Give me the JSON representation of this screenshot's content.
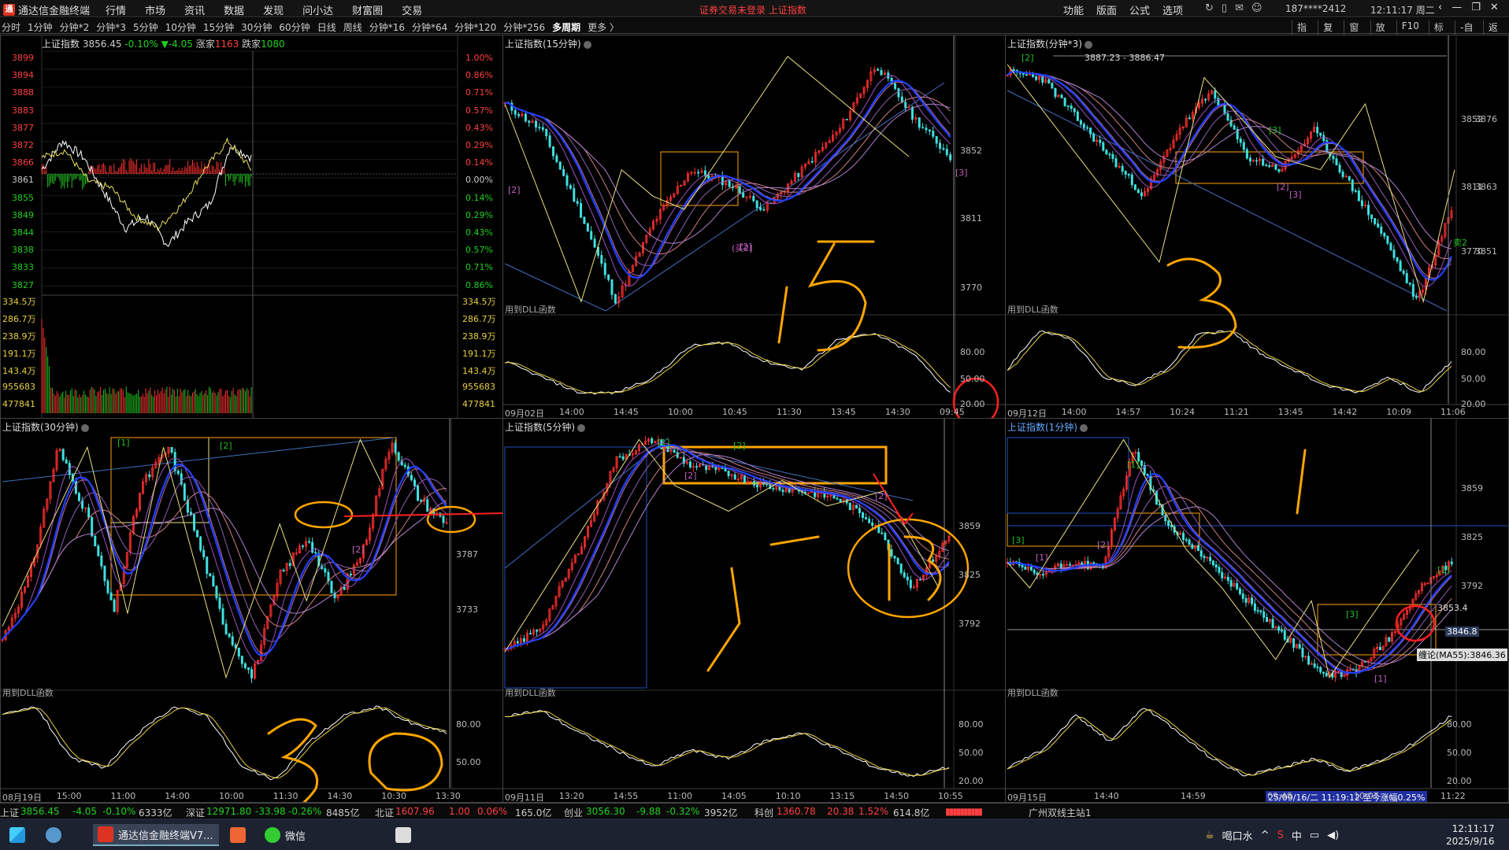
{
  "titlebar": {
    "app": "通达信金融终端",
    "menus": [
      "行情",
      "市场",
      "资讯",
      "数据",
      "发现",
      "问小达",
      "财富圈",
      "交易"
    ],
    "notice": "证券交易未登录  上证指数",
    "right_menus": [
      "功能",
      "版面",
      "公式",
      "选项"
    ],
    "account": "187****2412",
    "clock": "12:11:17 周二"
  },
  "periods": [
    "分时",
    "1分钟",
    "分钟*2",
    "分钟*3",
    "5分钟",
    "10分钟",
    "15分钟",
    "30分钟",
    "60分钟",
    "日线",
    "周线",
    "分钟*16",
    "分钟*64",
    "分钟*120",
    "分钟*256",
    "多周期",
    "更多 〉"
  ],
  "rtools": [
    "指标",
    "复权",
    "窗口",
    "放大",
    "F10",
    "标记",
    "-自选",
    "返回"
  ],
  "p1": {
    "name": "上证指数",
    "price": "3856.45",
    "pct": "-0.10%",
    "chg": "▼-4.05",
    "up_label": "涨家",
    "up": "1163",
    "down_label": "跌家",
    "down": "1080",
    "left_axis": [
      "3899",
      "3894",
      "3888",
      "3883",
      "3877",
      "3872",
      "3866",
      "3861",
      "3855",
      "3849",
      "3844",
      "3838",
      "3833",
      "3827"
    ],
    "right_axis": [
      "1.00%",
      "0.86%",
      "0.71%",
      "0.57%",
      "0.43%",
      "0.29%",
      "0.14%",
      "0.00%",
      "0.14%",
      "0.29%",
      "0.43%",
      "0.57%",
      "0.71%",
      "0.86%"
    ],
    "vol_axis": [
      "334.5万",
      "286.7万",
      "238.9万",
      "191.1万",
      "143.4万",
      "955683",
      "477841"
    ]
  },
  "p2": {
    "title": "上证指数(15分钟)",
    "func": "用到DLL函数",
    "axis": [
      "3852",
      "3811",
      "3770"
    ],
    "kdj": [
      "80.00",
      "50.00",
      "20.00"
    ],
    "times": [
      "09月02日",
      "14:00",
      "14:45",
      "10:00",
      "10:45",
      "11:30",
      "13:45",
      "14:30",
      "09:45"
    ],
    "marks": [
      "[2]",
      "[3]",
      "[2]",
      "(买2]"
    ],
    "hand": "15"
  },
  "p3": {
    "title": "上证指数(分钟*3)",
    "range": "3887.23 - 3886.47",
    "axis": [
      "3852",
      "3811",
      "3770"
    ],
    "raxis": [
      "3876",
      "3863",
      "3851"
    ],
    "kdj": [
      "80.00",
      "50.00",
      "20.00"
    ],
    "times": [
      "09月12日",
      "14:00",
      "14:57",
      "10:24",
      "11:21",
      "13:45",
      "14:42",
      "10:09",
      "11:06"
    ],
    "marks": [
      "[2]",
      "[3]",
      "[2]",
      "[3]",
      "卖2"
    ],
    "func": "用到DLL函数",
    "hand": "3"
  },
  "p4": {
    "title": "上证指数(30分钟)",
    "func": "用到DLL函数",
    "axis": [
      "3787",
      "3733"
    ],
    "kdj": [
      "80.00",
      "50.00"
    ],
    "times": [
      "08月19日",
      "15:00",
      "11:00",
      "14:00",
      "10:00",
      "11:30",
      "14:30",
      "10:30",
      "13:30"
    ],
    "marks": [
      "[1]",
      "[2]",
      "[2]"
    ],
    "hand": "30"
  },
  "p5": {
    "title": "上证指数(5分钟)",
    "func": "用到DLL函数",
    "axis": [
      "3859",
      "3825",
      "3792"
    ],
    "kdj": [
      "80.00",
      "50.00",
      "20.00"
    ],
    "times": [
      "09月11日",
      "13:20",
      "14:55",
      "11:00",
      "14:05",
      "10:10",
      "13:15",
      "14:50",
      "10:55"
    ],
    "marks": [
      "[1]",
      "[2]",
      "[2]",
      "[2]"
    ],
    "hand": "5",
    "circle": "13"
  },
  "p6": {
    "title": "上证指数(1分钟)",
    "func": "用到DLL函数",
    "axis": [
      "3859",
      "3825",
      "3792"
    ],
    "raxis": [
      "80.00",
      "50.00",
      "20.00"
    ],
    "times": [
      "09月15日",
      "14:40",
      "14:59",
      "09:48",
      "10:07",
      "11:22"
    ],
    "marks": [
      "[1]",
      "[3]",
      "[2]",
      "[1]",
      "[3]",
      "[1]",
      "[1]"
    ],
    "p1": "3853.4",
    "p2": "3846.8",
    "ma": "缠论(MA55):3846.36",
    "date": "25/09/16/二 11:19:12 至今涨幅0.25%",
    "hand": "1"
  },
  "status": {
    "sh_label": "上证",
    "sh": "3856.45",
    "sh_chg": "-4.05",
    "sh_pct": "-0.10%",
    "sh_amt": "6333亿",
    "sz_label": "深证",
    "sz": "12971.80",
    "sz_chg": "-33.98",
    "sz_pct": "-0.26%",
    "sz_amt": "8485亿",
    "bz_label": "北证",
    "bz": "1607.96",
    "bz_chg": "1.00",
    "bz_pct": "0.06%",
    "bz_amt": "165.0亿",
    "cy_label": "创业",
    "cy": "3056.30",
    "cy_chg": "-9.88",
    "cy_pct": "-0.32%",
    "cy_amt": "3952亿",
    "kc_label": "科创",
    "kc": "1360.78",
    "kc_chg": "20.38",
    "kc_pct": "1.52%",
    "kc_amt": "614.8亿",
    "station": "广州双线主站1"
  },
  "taskbar": {
    "app1": "通达信金融终端V7...",
    "app2": "微信",
    "weather": "喝口水",
    "time": "12:11:17",
    "date": "2025/9/16",
    "ime": "中"
  },
  "colors": {
    "up": "#ff4040",
    "down": "#20d020",
    "yellow": "#e8d040",
    "orange": "#ffa500",
    "red": "#ff2020"
  }
}
